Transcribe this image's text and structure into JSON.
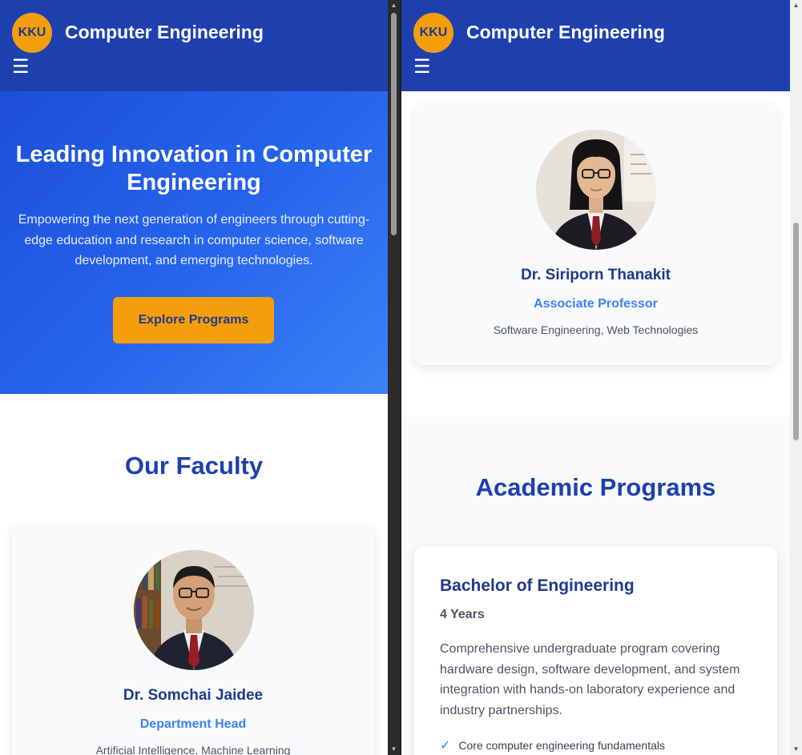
{
  "brand": {
    "logo_text": "KKU",
    "title": "Computer Engineering",
    "menu_icon": "hamburger-icon"
  },
  "hero": {
    "title": "Leading Innovation in Computer Engineering",
    "subtitle": "Empowering the next generation of engineers through cutting-edge education and research in computer science, software development, and emerging technologies.",
    "cta": "Explore Programs"
  },
  "faculty": {
    "heading": "Our Faculty",
    "members": [
      {
        "name": "Dr. Somchai Jaidee",
        "role": "Department Head",
        "areas": "Artificial Intelligence, Machine Learning"
      },
      {
        "name": "Dr. Siriporn Thanakit",
        "role": "Associate Professor",
        "areas": "Software Engineering, Web Technologies"
      }
    ]
  },
  "programs": {
    "heading": "Academic Programs",
    "items": [
      {
        "title": "Bachelor of Engineering",
        "duration": "4 Years",
        "description": "Comprehensive undergraduate program covering hardware design, software development, and system integration with hands-on laboratory experience and industry partnerships.",
        "features": [
          "Core computer engineering fundamentals"
        ]
      }
    ]
  },
  "colors": {
    "primary": "#1e40af",
    "accent": "#f59e0b",
    "link": "#3b82f6",
    "card_bg": "#f8fafc"
  }
}
